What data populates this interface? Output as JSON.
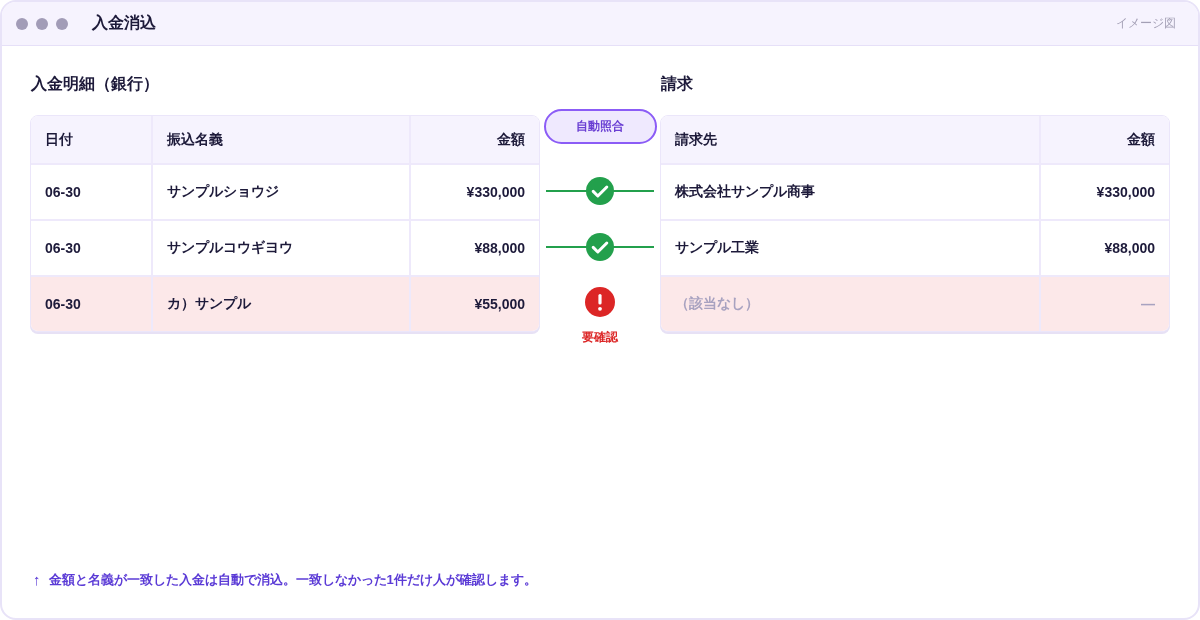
{
  "window": {
    "title": "入金消込",
    "tag": "イメージ図"
  },
  "bank_statement": {
    "title": "入金明細（銀行）",
    "columns": [
      {
        "kind": "date",
        "label": "日付"
      },
      {
        "kind": "text",
        "label": "振込名義"
      },
      {
        "kind": "amount",
        "label": "金額"
      }
    ],
    "rows": [
      {
        "cells": [
          "06-30",
          "サンプルショウジ",
          "¥330,000"
        ],
        "flagged": false
      },
      {
        "cells": [
          "06-30",
          "サンプルコウギヨウ",
          "¥88,000"
        ],
        "flagged": false
      },
      {
        "cells": [
          "06-30",
          "カ）サンプル",
          "¥55,000"
        ],
        "flagged": true
      }
    ]
  },
  "matching": {
    "button": "自動照合",
    "results": [
      {
        "kind": "matched"
      },
      {
        "kind": "matched"
      },
      {
        "kind": "review",
        "label": "要確認"
      }
    ]
  },
  "invoices": {
    "title": "請求",
    "columns": [
      {
        "kind": "text",
        "label": "請求先"
      },
      {
        "kind": "amount",
        "label": "金額"
      }
    ],
    "rows": [
      {
        "cells": [
          "株式会社サンプル商事",
          "¥330,000"
        ],
        "flagged": false,
        "empty": false
      },
      {
        "cells": [
          "サンプル工業",
          "¥88,000"
        ],
        "flagged": false,
        "empty": false
      },
      {
        "cells": [
          "（該当なし）",
          "—"
        ],
        "flagged": true,
        "empty": true
      }
    ]
  },
  "note": {
    "icon": "↑",
    "text": "金額と名義が一致した入金は自動で消込。一致しなかった1件だけ人が確認します。"
  }
}
